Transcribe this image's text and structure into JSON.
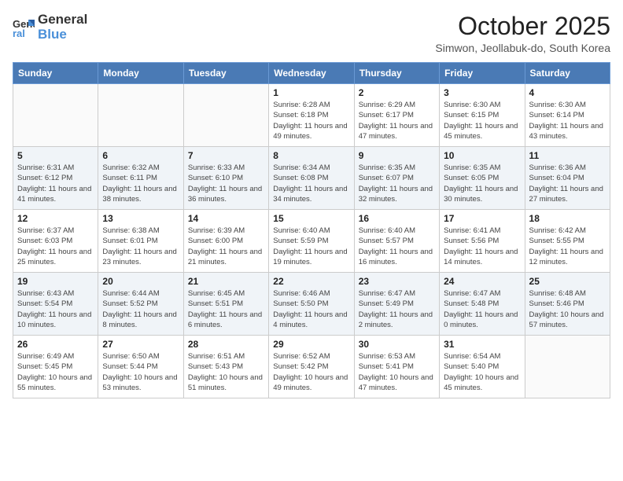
{
  "header": {
    "logo_general": "General",
    "logo_blue": "Blue",
    "month": "October 2025",
    "location": "Simwon, Jeollabuk-do, South Korea"
  },
  "weekdays": [
    "Sunday",
    "Monday",
    "Tuesday",
    "Wednesday",
    "Thursday",
    "Friday",
    "Saturday"
  ],
  "weeks": [
    [
      {
        "day": "",
        "info": ""
      },
      {
        "day": "",
        "info": ""
      },
      {
        "day": "",
        "info": ""
      },
      {
        "day": "1",
        "info": "Sunrise: 6:28 AM\nSunset: 6:18 PM\nDaylight: 11 hours and 49 minutes."
      },
      {
        "day": "2",
        "info": "Sunrise: 6:29 AM\nSunset: 6:17 PM\nDaylight: 11 hours and 47 minutes."
      },
      {
        "day": "3",
        "info": "Sunrise: 6:30 AM\nSunset: 6:15 PM\nDaylight: 11 hours and 45 minutes."
      },
      {
        "day": "4",
        "info": "Sunrise: 6:30 AM\nSunset: 6:14 PM\nDaylight: 11 hours and 43 minutes."
      }
    ],
    [
      {
        "day": "5",
        "info": "Sunrise: 6:31 AM\nSunset: 6:12 PM\nDaylight: 11 hours and 41 minutes."
      },
      {
        "day": "6",
        "info": "Sunrise: 6:32 AM\nSunset: 6:11 PM\nDaylight: 11 hours and 38 minutes."
      },
      {
        "day": "7",
        "info": "Sunrise: 6:33 AM\nSunset: 6:10 PM\nDaylight: 11 hours and 36 minutes."
      },
      {
        "day": "8",
        "info": "Sunrise: 6:34 AM\nSunset: 6:08 PM\nDaylight: 11 hours and 34 minutes."
      },
      {
        "day": "9",
        "info": "Sunrise: 6:35 AM\nSunset: 6:07 PM\nDaylight: 11 hours and 32 minutes."
      },
      {
        "day": "10",
        "info": "Sunrise: 6:35 AM\nSunset: 6:05 PM\nDaylight: 11 hours and 30 minutes."
      },
      {
        "day": "11",
        "info": "Sunrise: 6:36 AM\nSunset: 6:04 PM\nDaylight: 11 hours and 27 minutes."
      }
    ],
    [
      {
        "day": "12",
        "info": "Sunrise: 6:37 AM\nSunset: 6:03 PM\nDaylight: 11 hours and 25 minutes."
      },
      {
        "day": "13",
        "info": "Sunrise: 6:38 AM\nSunset: 6:01 PM\nDaylight: 11 hours and 23 minutes."
      },
      {
        "day": "14",
        "info": "Sunrise: 6:39 AM\nSunset: 6:00 PM\nDaylight: 11 hours and 21 minutes."
      },
      {
        "day": "15",
        "info": "Sunrise: 6:40 AM\nSunset: 5:59 PM\nDaylight: 11 hours and 19 minutes."
      },
      {
        "day": "16",
        "info": "Sunrise: 6:40 AM\nSunset: 5:57 PM\nDaylight: 11 hours and 16 minutes."
      },
      {
        "day": "17",
        "info": "Sunrise: 6:41 AM\nSunset: 5:56 PM\nDaylight: 11 hours and 14 minutes."
      },
      {
        "day": "18",
        "info": "Sunrise: 6:42 AM\nSunset: 5:55 PM\nDaylight: 11 hours and 12 minutes."
      }
    ],
    [
      {
        "day": "19",
        "info": "Sunrise: 6:43 AM\nSunset: 5:54 PM\nDaylight: 11 hours and 10 minutes."
      },
      {
        "day": "20",
        "info": "Sunrise: 6:44 AM\nSunset: 5:52 PM\nDaylight: 11 hours and 8 minutes."
      },
      {
        "day": "21",
        "info": "Sunrise: 6:45 AM\nSunset: 5:51 PM\nDaylight: 11 hours and 6 minutes."
      },
      {
        "day": "22",
        "info": "Sunrise: 6:46 AM\nSunset: 5:50 PM\nDaylight: 11 hours and 4 minutes."
      },
      {
        "day": "23",
        "info": "Sunrise: 6:47 AM\nSunset: 5:49 PM\nDaylight: 11 hours and 2 minutes."
      },
      {
        "day": "24",
        "info": "Sunrise: 6:47 AM\nSunset: 5:48 PM\nDaylight: 11 hours and 0 minutes."
      },
      {
        "day": "25",
        "info": "Sunrise: 6:48 AM\nSunset: 5:46 PM\nDaylight: 10 hours and 57 minutes."
      }
    ],
    [
      {
        "day": "26",
        "info": "Sunrise: 6:49 AM\nSunset: 5:45 PM\nDaylight: 10 hours and 55 minutes."
      },
      {
        "day": "27",
        "info": "Sunrise: 6:50 AM\nSunset: 5:44 PM\nDaylight: 10 hours and 53 minutes."
      },
      {
        "day": "28",
        "info": "Sunrise: 6:51 AM\nSunset: 5:43 PM\nDaylight: 10 hours and 51 minutes."
      },
      {
        "day": "29",
        "info": "Sunrise: 6:52 AM\nSunset: 5:42 PM\nDaylight: 10 hours and 49 minutes."
      },
      {
        "day": "30",
        "info": "Sunrise: 6:53 AM\nSunset: 5:41 PM\nDaylight: 10 hours and 47 minutes."
      },
      {
        "day": "31",
        "info": "Sunrise: 6:54 AM\nSunset: 5:40 PM\nDaylight: 10 hours and 45 minutes."
      },
      {
        "day": "",
        "info": ""
      }
    ]
  ]
}
